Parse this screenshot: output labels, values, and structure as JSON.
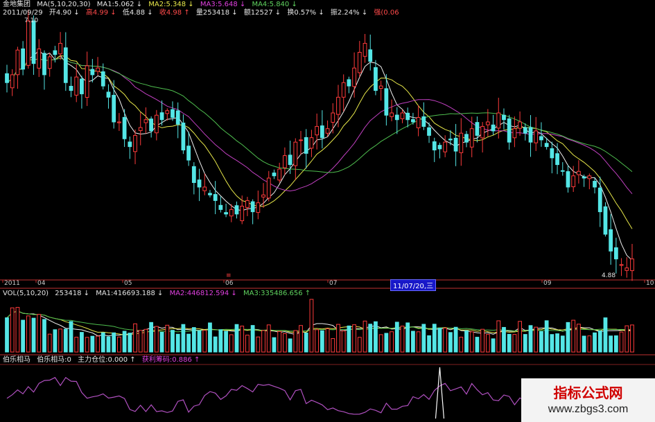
{
  "header": {
    "stock_name": "金地集团",
    "ma_title": "MA(5,10,20,30)",
    "ma1": "MA1:5.062 ↓",
    "ma2": "MA2:5.348 ↓",
    "ma3": "MA3:5.648 ↓",
    "ma4": "MA4:5.840 ↓",
    "date": "2011/09/29",
    "open": "开4.90 ↓",
    "high": "高4.99 ↓",
    "low": "低4.88 ↓",
    "close": "收4.98 ↑",
    "volume": "量253418 ↓",
    "amount": "额12527 ↓",
    "turnover": "换0.57% ↓",
    "amplitude": "振2.24% ↓",
    "strength": "强(0.06"
  },
  "price_labels": {
    "high_marker": "7.10",
    "low_marker": "4.88"
  },
  "time_axis": {
    "ticks": [
      "2011",
      "04",
      "05",
      "06",
      "07",
      "09",
      "10"
    ],
    "cursor_date": "11/07/20,三",
    "event_marker": "≡"
  },
  "volume_header": {
    "title": "VOL(5,10,20)",
    "value": "253418 ↓",
    "ma1": "MA1:416693.188 ↓",
    "ma2": "MA2:446812.594 ↓",
    "ma3": "MA3:335486.656 ↑"
  },
  "indicator_header": {
    "name": "伯乐相马",
    "value": "伯乐相马:0",
    "position": "主力仓位:0.000 ↑",
    "profit": "获利筹码:0.886 ↑"
  },
  "watermark": {
    "line1": "指标公式网",
    "line2": "www.zbgs3.com"
  },
  "colors": {
    "up": "#ff3b3b",
    "down": "#54e6e6",
    "ma5": "#f0f0f0",
    "ma10": "#e8e84a",
    "ma20": "#c040c0",
    "ma30": "#4fbf4f",
    "indicator": "#b050c0",
    "spike": "#ffffff"
  },
  "chart_data": {
    "type": "candlestick",
    "price_range": [
      4.88,
      7.1
    ],
    "closes": [
      6.55,
      6.62,
      6.84,
      6.67,
      7.1,
      6.72,
      6.85,
      6.62,
      6.78,
      6.8,
      6.9,
      6.55,
      6.48,
      6.6,
      6.45,
      6.7,
      6.62,
      6.68,
      6.52,
      6.42,
      6.2,
      6.2,
      6.05,
      5.98,
      6.08,
      6.15,
      6.22,
      6.12,
      6.26,
      6.22,
      6.3,
      6.24,
      6.18,
      5.95,
      5.86,
      5.66,
      5.62,
      5.62,
      5.55,
      5.5,
      5.42,
      5.38,
      5.42,
      5.38,
      5.45,
      5.5,
      5.4,
      5.48,
      5.55,
      5.7,
      5.72,
      5.78,
      5.9,
      5.82,
      6.02,
      6.04,
      5.92,
      6.06,
      6.16,
      6.06,
      6.14,
      6.28,
      6.42,
      6.55,
      6.52,
      6.68,
      6.82,
      6.9,
      6.74,
      6.48,
      6.52,
      6.26,
      6.28,
      6.22,
      6.28,
      6.22,
      6.2,
      6.24,
      6.16,
      6.08,
      5.95,
      5.96,
      6.02,
      6.04,
      5.94,
      6.1,
      6.02,
      6.14,
      6.08,
      6.16,
      6.2,
      6.12,
      6.28,
      6.22,
      6.02,
      6.14,
      6.2,
      6.1,
      6.02,
      6.12,
      6.04,
      5.98,
      5.88,
      5.82,
      5.76,
      5.62,
      5.72,
      5.76,
      5.7,
      5.72,
      5.62,
      5.4,
      5.2,
      5.05,
      4.98,
      4.93,
      4.9,
      4.98
    ],
    "volume_max": 1000000,
    "indicator_spike_index": 81
  }
}
